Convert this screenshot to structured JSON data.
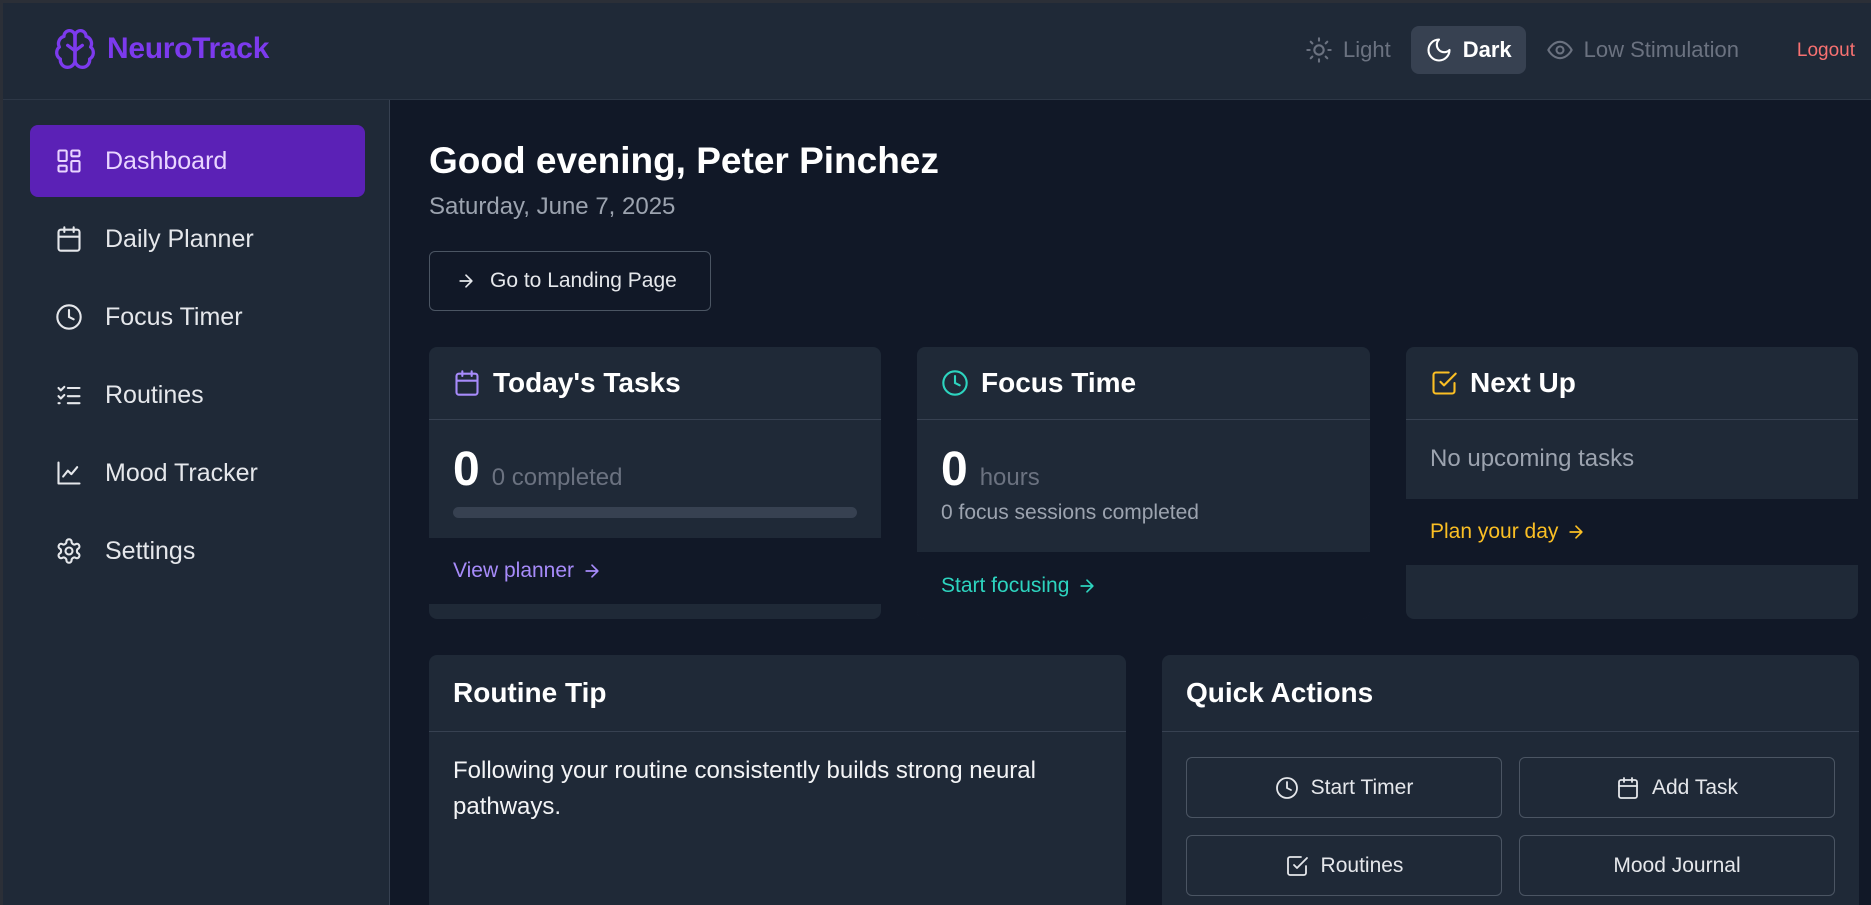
{
  "app": {
    "name": "NeuroTrack",
    "brand_color": "#7c3aed"
  },
  "header": {
    "themes": [
      {
        "label": "Light",
        "icon": "sun-icon",
        "active": false
      },
      {
        "label": "Dark",
        "icon": "moon-icon",
        "active": true
      },
      {
        "label": "Low Stimulation",
        "icon": "eye-icon",
        "active": false
      }
    ],
    "logout_label": "Logout"
  },
  "sidebar": {
    "items": [
      {
        "label": "Dashboard",
        "icon": "dashboard-icon",
        "active": true
      },
      {
        "label": "Daily Planner",
        "icon": "calendar-icon",
        "active": false
      },
      {
        "label": "Focus Timer",
        "icon": "clock-icon",
        "active": false
      },
      {
        "label": "Routines",
        "icon": "list-checks-icon",
        "active": false
      },
      {
        "label": "Mood Tracker",
        "icon": "line-chart-icon",
        "active": false
      },
      {
        "label": "Settings",
        "icon": "gear-icon",
        "active": false
      }
    ]
  },
  "main": {
    "greeting": "Good evening, Peter Pinchez",
    "date": "Saturday, June 7, 2025",
    "landing_button": "Go to Landing Page",
    "tasks_card": {
      "title": "Today's Tasks",
      "count": "0",
      "subtitle": "0 completed",
      "progress": 0,
      "link": "View planner",
      "accent": "#a78bfa"
    },
    "focus_card": {
      "title": "Focus Time",
      "count": "0",
      "unit": "hours",
      "sessions": "0 focus sessions completed",
      "link": "Start focusing",
      "accent": "#2dd4bf"
    },
    "next_card": {
      "title": "Next Up",
      "empty_text": "No upcoming tasks",
      "link": "Plan your day",
      "accent": "#fbbf24"
    },
    "tip_card": {
      "title": "Routine Tip",
      "text": "Following your routine consistently builds strong neural pathways."
    },
    "quick_actions": {
      "title": "Quick Actions",
      "buttons": [
        {
          "label": "Start Timer",
          "icon": "clock-icon"
        },
        {
          "label": "Add Task",
          "icon": "calendar-icon"
        },
        {
          "label": "Routines",
          "icon": "checkbox-icon"
        },
        {
          "label": "Mood Journal",
          "icon": ""
        }
      ]
    }
  }
}
